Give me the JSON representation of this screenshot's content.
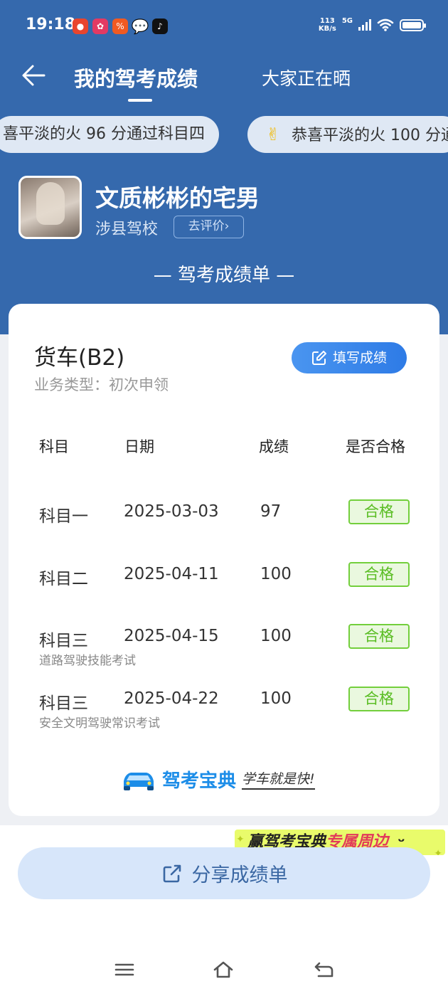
{
  "status_bar": {
    "time": "19:18",
    "net_speed_value": "113",
    "net_speed_unit": "KB/s",
    "network": "5G",
    "apps": [
      "app-red-icon",
      "app-pink-icon",
      "app-orange-icon",
      "chat-bubble-icon",
      "tiktok-icon"
    ]
  },
  "nav": {
    "tab_mine": "我的驾考成绩",
    "tab_all": "大家正在晒"
  },
  "marquee": [
    "喜平淡的火 96 分通过科目四",
    "恭喜平淡的火 100 分通"
  ],
  "profile": {
    "name": "文质彬彬的宅男",
    "school": "涉县驾校",
    "rate_button": "去评价"
  },
  "report_title": "— 驾考成绩单 —",
  "card": {
    "vehicle": "货车(B2)",
    "business_type": "业务类型：初次申领",
    "fill_button": "填写成绩",
    "headers": {
      "subject": "科目",
      "date": "日期",
      "score": "成绩",
      "pass": "是否合格"
    },
    "rows": [
      {
        "subject": "科目一",
        "date": "2025-03-03",
        "score": "97",
        "pass": "合格",
        "note": ""
      },
      {
        "subject": "科目二",
        "date": "2025-04-11",
        "score": "100",
        "pass": "合格",
        "note": ""
      },
      {
        "subject": "科目三",
        "date": "2025-04-15",
        "score": "100",
        "pass": "合格",
        "note": "道路驾驶技能考试"
      },
      {
        "subject": "科目三",
        "date": "2025-04-22",
        "score": "100",
        "pass": "合格",
        "note": "安全文明驾驶常识考试"
      }
    ],
    "brand_name": "驾考宝典",
    "brand_slogan": "学车就是快!"
  },
  "promo": {
    "part1": "赢驾考宝典",
    "part2": "专属周边"
  },
  "share_button": "分享成绩单",
  "colors": {
    "header_blue": "#3569ad",
    "pass_green": "#59bd22",
    "button_blue": "#2e7be6"
  }
}
